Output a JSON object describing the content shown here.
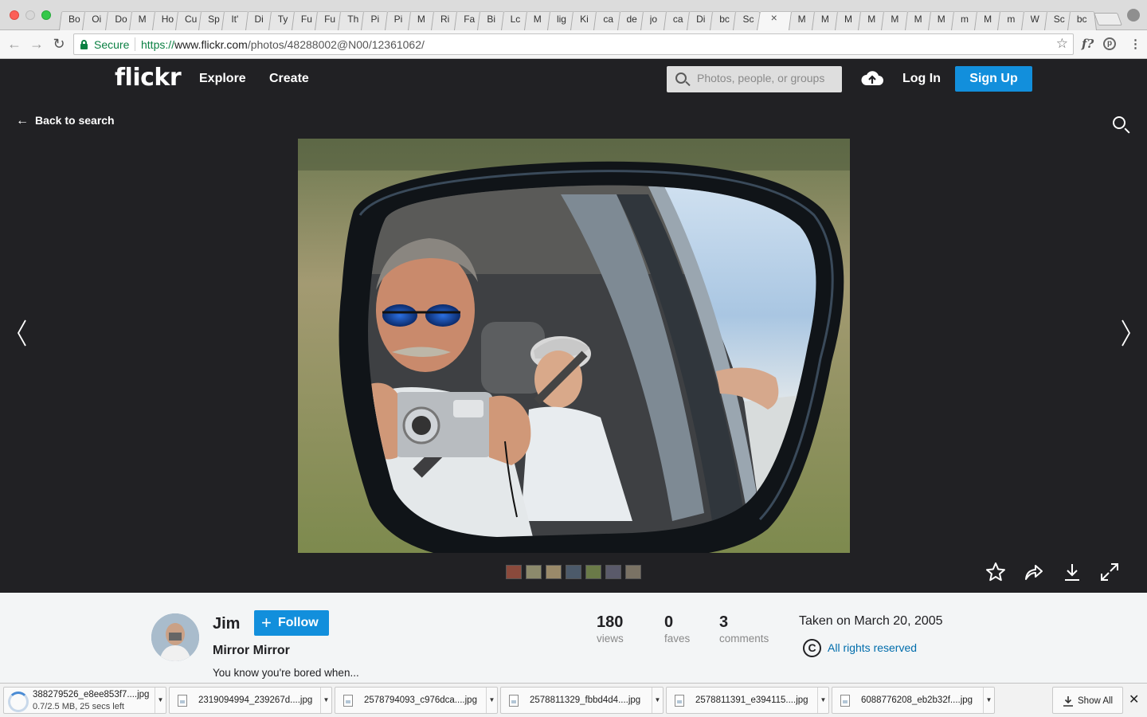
{
  "browser": {
    "tabs": [
      "Bo",
      "Oi",
      "Do",
      "M",
      "Ho",
      "Cu",
      "Sp",
      "It'",
      "Di",
      "Ty",
      "Fu",
      "Fu",
      "Th",
      "Pi",
      "Pi",
      "M",
      "Ri",
      "Fa",
      "Bi",
      "Lc",
      "M",
      "lig",
      "Ki",
      "ca",
      "de",
      "jo",
      "ca",
      "Di",
      "bc",
      "Sc",
      "×",
      "M",
      "M",
      "M",
      "M",
      "M",
      "M",
      "M",
      "m",
      "M",
      "m",
      "W",
      "Sc",
      "bc"
    ],
    "active_tab_index": 30,
    "secure_label": "Secure",
    "url_scheme": "https://",
    "url_host": "www.flickr.com",
    "url_path": "/photos/48288002@N00/12361062/",
    "extension_icons": [
      "font-icon",
      "pinterest-icon",
      "menu-icon"
    ]
  },
  "header": {
    "logo": "flickr",
    "nav": [
      "Explore",
      "Create"
    ],
    "search_placeholder": "Photos, people, or groups",
    "login": "Log In",
    "signup": "Sign Up"
  },
  "stage": {
    "back_label": "Back to search",
    "filmstrip_count": 7
  },
  "photo_info": {
    "owner": "Jim",
    "follow_label": "Follow",
    "title": "Mirror Mirror",
    "description": "You know you're bored when...",
    "stats": [
      {
        "value": "180",
        "label": "views"
      },
      {
        "value": "0",
        "label": "faves"
      },
      {
        "value": "3",
        "label": "comments"
      }
    ],
    "taken": "Taken on March 20, 2005",
    "license_icon": "C",
    "license": "All rights reserved"
  },
  "downloads": {
    "items": [
      {
        "name": "388279526_e8ee853f7....jpg",
        "status": "0.7/2.5 MB, 25 secs left"
      },
      {
        "name": "2319094994_239267d....jpg"
      },
      {
        "name": "2578794093_c976dca....jpg"
      },
      {
        "name": "2578811329_fbbd4d4....jpg"
      },
      {
        "name": "2578811391_e394115....jpg"
      },
      {
        "name": "6088776208_eb2b32f....jpg"
      }
    ],
    "show_all": "Show All"
  },
  "colors": {
    "flickr_blue": "#128fdc",
    "dark_bg": "#212124",
    "link_blue": "#006dac"
  }
}
